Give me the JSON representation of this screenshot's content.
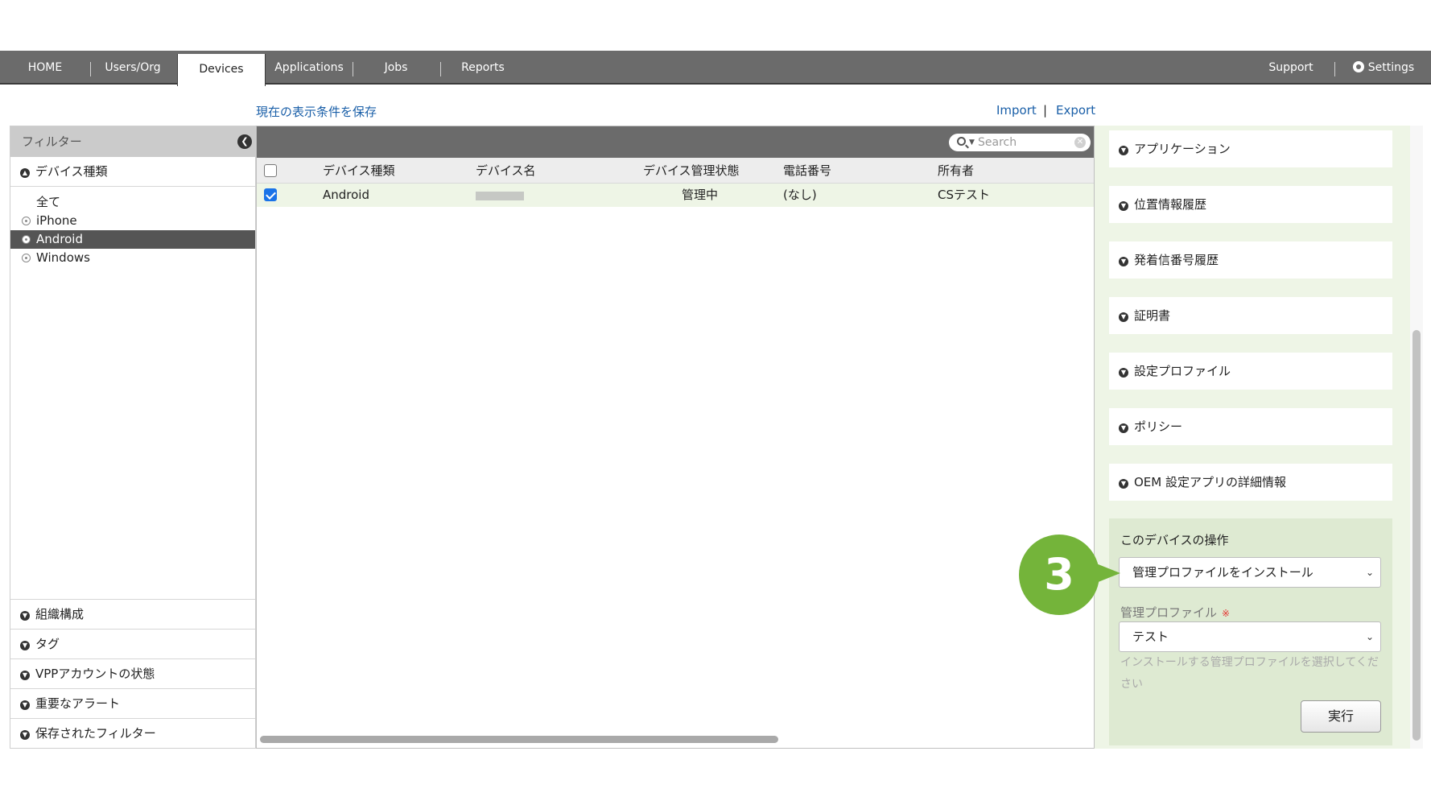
{
  "nav": {
    "items": [
      {
        "label": "HOME"
      },
      {
        "label": "Users/Org"
      },
      {
        "label": "Devices"
      },
      {
        "label": "Applications"
      },
      {
        "label": "Jobs"
      },
      {
        "label": "Reports"
      }
    ],
    "support": "Support",
    "settings": "Settings",
    "active": "Devices"
  },
  "links": {
    "save_view": "現在の表示条件を保存",
    "import": "Import",
    "separator": "|",
    "export": "Export"
  },
  "sidebar": {
    "filter_title": "フィルター",
    "device_type_title": "デバイス種類",
    "device_types": [
      {
        "label": "全て"
      },
      {
        "label": "iPhone"
      },
      {
        "label": "Android"
      },
      {
        "label": "Windows"
      }
    ],
    "selected_type": "Android",
    "bottom_sections": [
      {
        "label": "組織構成"
      },
      {
        "label": "タグ"
      },
      {
        "label": "VPPアカウントの状態"
      },
      {
        "label": "重要なアラート"
      },
      {
        "label": "保存されたフィルター"
      }
    ]
  },
  "table": {
    "search_placeholder": "Search",
    "columns": [
      "デバイス種類",
      "デバイス名",
      "デバイス管理状態",
      "電話番号",
      "所有者"
    ],
    "rows": [
      {
        "type": "Android",
        "name": "",
        "status": "管理中",
        "phone": "(なし)",
        "owner": "CSテスト",
        "checked": true
      }
    ]
  },
  "right_panel": {
    "sections": [
      {
        "label": "アプリケーション"
      },
      {
        "label": "位置情報履歴"
      },
      {
        "label": "発着信番号履歴"
      },
      {
        "label": "証明書"
      },
      {
        "label": "設定プロファイル"
      },
      {
        "label": "ポリシー"
      },
      {
        "label": "OEM 設定アプリの詳細情報"
      }
    ],
    "operations": {
      "title": "このデバイスの操作",
      "action_value": "管理プロファイルをインストール",
      "profile_label": "管理プロファイル",
      "required_mark": "※",
      "profile_value": "テスト",
      "hint": "インストールする管理プロファイルを選択してください",
      "run_label": "実行"
    }
  },
  "step_marker": "3",
  "colors": {
    "nav_bg": "#6b6b6b",
    "link": "#1a5fa8",
    "panel_bg": "#eef5e6",
    "step": "#74b43a",
    "selected": "#555555"
  }
}
